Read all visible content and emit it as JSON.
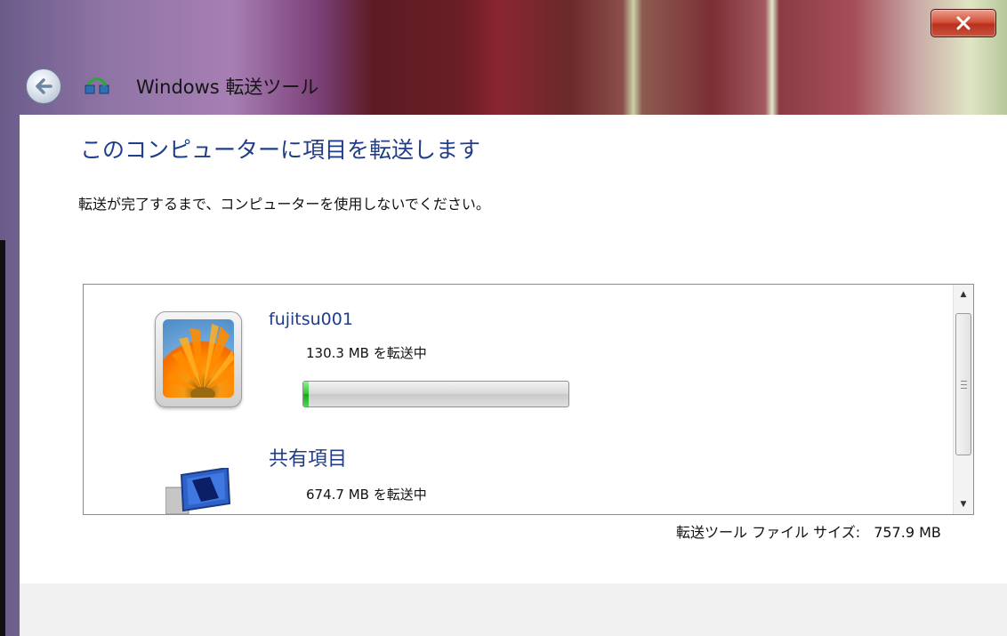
{
  "window": {
    "title": "Windows 転送ツール",
    "close_icon": "close-icon",
    "back_icon": "back-arrow-icon"
  },
  "main": {
    "heading": "このコンピューターに項目を転送します",
    "instruction": "転送が完了するまで、コンピューターを使用しないでください。"
  },
  "transfer_list": {
    "items": [
      {
        "name": "fujitsu001",
        "status": "130.3 MB を転送中",
        "icon": "user-picture-icon",
        "progress_percent": 2
      },
      {
        "name": "共有項目",
        "status": "674.7 MB を転送中",
        "icon": "shared-items-icon"
      }
    ]
  },
  "file_size": {
    "label": "転送ツール ファイル サイズ:",
    "value": "757.9 MB"
  },
  "colors": {
    "heading": "#1f3d8a",
    "progress_fill": "#2fc32f",
    "close_button": "#c9553e"
  }
}
